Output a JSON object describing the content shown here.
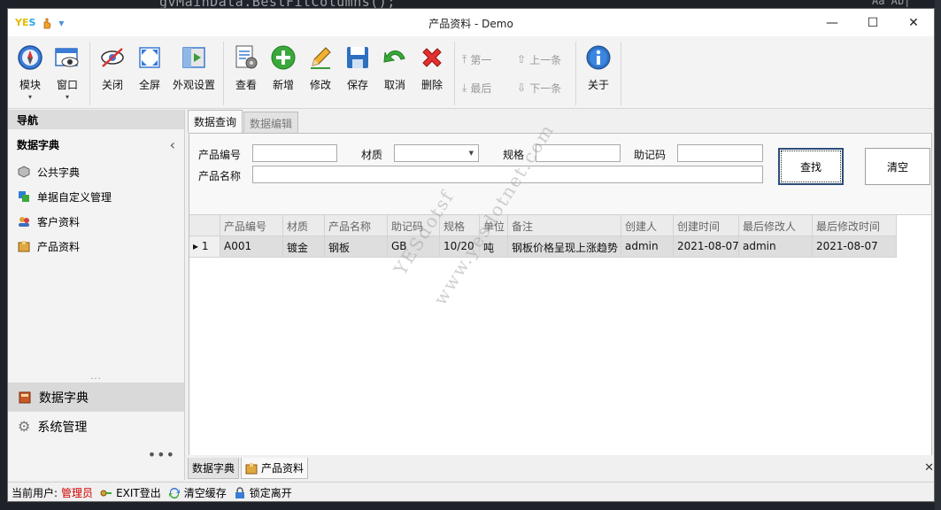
{
  "background": {
    "code_text": "gvMainData.BestFitColumns();",
    "code_text_right": "Aa  Ab|"
  },
  "titlebar": {
    "logo_a": "YE",
    "logo_b": "S",
    "title": "产品资料 - Demo",
    "minimize": "—",
    "maximize": "☐",
    "close": "✕"
  },
  "ribbon": {
    "groups": [
      [
        {
          "label": "模块",
          "icon": "compass-icon",
          "dropdown": true
        },
        {
          "label": "窗口",
          "icon": "window-icon",
          "dropdown": true
        }
      ],
      [
        {
          "label": "关闭",
          "icon": "hide-eye-icon"
        },
        {
          "label": "全屏",
          "icon": "fullscreen-icon"
        },
        {
          "label": "外观设置",
          "icon": "appearance-icon"
        }
      ],
      [
        {
          "label": "查看",
          "icon": "view-doc-icon"
        },
        {
          "label": "新增",
          "icon": "add-icon"
        },
        {
          "label": "修改",
          "icon": "edit-pencil-icon"
        },
        {
          "label": "保存",
          "icon": "save-icon"
        },
        {
          "label": "取消",
          "icon": "undo-icon"
        },
        {
          "label": "删除",
          "icon": "delete-icon"
        }
      ]
    ],
    "nav": {
      "first": "第一",
      "last": "最后",
      "prev": "上一条",
      "next": "下一条"
    },
    "about": "关于"
  },
  "leftnav": {
    "header": "导航",
    "group": "数据字典",
    "collapse": "‹",
    "items": [
      {
        "label": "公共字典",
        "color": "#8a8a8a"
      },
      {
        "label": "单据自定义管理",
        "color": "#2f7fd8"
      },
      {
        "label": "客户资料",
        "color": "#d04040"
      },
      {
        "label": "产品资料",
        "color": "#d8a030"
      }
    ],
    "dots": "...",
    "panes": [
      {
        "label": "数据字典",
        "active": true
      },
      {
        "label": "系统管理",
        "active": false
      }
    ],
    "more": "•••"
  },
  "content": {
    "tabs": [
      {
        "label": "数据查询",
        "active": true
      },
      {
        "label": "数据编辑",
        "active": false
      }
    ],
    "form": {
      "product_code_label": "产品编号",
      "material_label": "材质",
      "spec_label": "规格",
      "mnemonic_label": "助记码",
      "product_name_label": "产品名称",
      "product_code_value": "",
      "material_value": "",
      "spec_value": "",
      "mnemonic_value": "",
      "product_name_value": "",
      "search_btn": "查找",
      "clear_btn": "清空"
    },
    "grid": {
      "columns": [
        "产品编号",
        "材质",
        "产品名称",
        "助记码",
        "规格",
        "单位",
        "备注",
        "创建人",
        "创建时间",
        "最后修改人",
        "最后修改时间"
      ],
      "rows": [
        {
          "indicator": "▸ 1",
          "cells": [
            "A001",
            "镀金",
            "钢板",
            "GB",
            "10/20",
            "吨",
            "钢板价格呈现上涨趋势",
            "admin",
            "2021-08-07",
            "admin",
            "2021-08-07"
          ]
        }
      ]
    },
    "watermark1": "YESdotsf",
    "watermark2": "www.yesdotnet.com"
  },
  "doctabs": [
    {
      "label": "数据字典",
      "active": false
    },
    {
      "label": "产品资料",
      "active": true
    }
  ],
  "doc_close": "✕",
  "statusbar": {
    "user_label": "当前用户:",
    "user_name": "管理员",
    "exit": "EXIT登出",
    "clear_cache": "清空缓存",
    "lock": "锁定离开"
  }
}
